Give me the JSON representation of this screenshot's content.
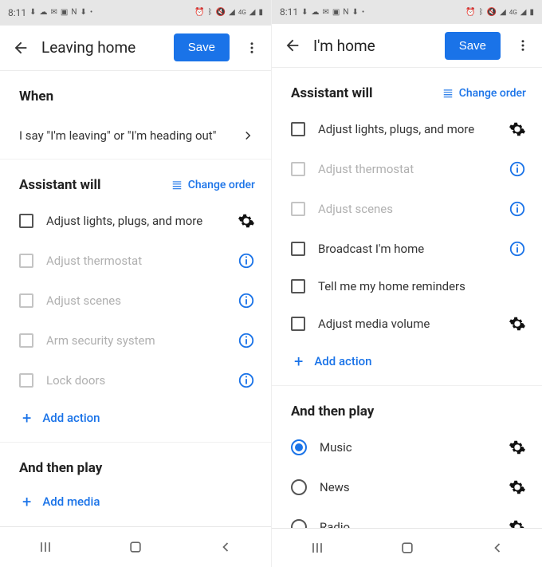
{
  "status": {
    "time": "8:11",
    "left_icons": [
      "download",
      "cloud",
      "message",
      "picture",
      "netflix",
      "download",
      "dot"
    ],
    "right_icons": [
      "alarm",
      "bluetooth",
      "mute",
      "wifi",
      "4g",
      "signal",
      "battery"
    ]
  },
  "left": {
    "title": "Leaving home",
    "save_label": "Save",
    "sections": {
      "when": {
        "title": "When",
        "trigger_text": "I say \"I'm leaving\" or \"I'm heading out\""
      },
      "assistant": {
        "title": "Assistant will",
        "change_order_label": "Change order",
        "items": [
          {
            "label": "Adjust lights, plugs, and more",
            "checkbox": true,
            "disabled": false,
            "trailing": "gear"
          },
          {
            "label": "Adjust thermostat",
            "checkbox": true,
            "disabled": true,
            "trailing": "info"
          },
          {
            "label": "Adjust scenes",
            "checkbox": true,
            "disabled": true,
            "trailing": "info"
          },
          {
            "label": "Arm security system",
            "checkbox": true,
            "disabled": true,
            "trailing": "info"
          },
          {
            "label": "Lock doors",
            "checkbox": true,
            "disabled": true,
            "trailing": "info"
          }
        ],
        "add_action_label": "Add action"
      },
      "play": {
        "title": "And then play",
        "add_media_label": "Add media"
      }
    }
  },
  "right": {
    "title": "I'm home",
    "save_label": "Save",
    "sections": {
      "assistant": {
        "title": "Assistant will",
        "change_order_label": "Change order",
        "items": [
          {
            "label": "Adjust lights, plugs, and more",
            "checkbox": true,
            "disabled": false,
            "trailing": "gear"
          },
          {
            "label": "Adjust thermostat",
            "checkbox": true,
            "disabled": true,
            "trailing": "info"
          },
          {
            "label": "Adjust scenes",
            "checkbox": true,
            "disabled": true,
            "trailing": "info"
          },
          {
            "label": "Broadcast I'm home",
            "checkbox": true,
            "disabled": false,
            "trailing": "info"
          },
          {
            "label": "Tell me my home reminders",
            "checkbox": true,
            "disabled": false,
            "trailing": null
          },
          {
            "label": "Adjust media volume",
            "checkbox": true,
            "disabled": false,
            "trailing": "gear"
          }
        ],
        "add_action_label": "Add action"
      },
      "play": {
        "title": "And then play",
        "items": [
          {
            "label": "Music",
            "radio": true,
            "selected": true,
            "trailing": "gear"
          },
          {
            "label": "News",
            "radio": true,
            "selected": false,
            "trailing": "gear"
          },
          {
            "label": "Radio",
            "radio": true,
            "selected": false,
            "trailing": "gear"
          }
        ]
      }
    }
  },
  "colors": {
    "accent": "#1a73e8"
  }
}
